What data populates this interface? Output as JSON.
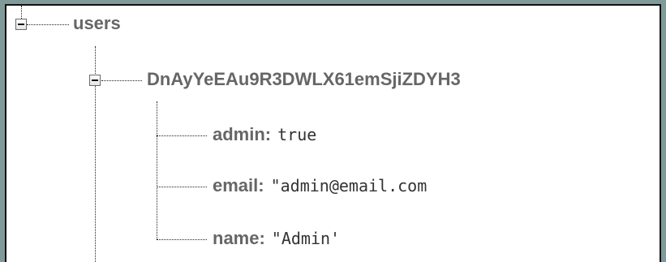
{
  "tree": {
    "root": {
      "key": "users"
    },
    "child": {
      "key": "DnAyYeEAu9R3DWLX61emSjiZDYH3",
      "fields": [
        {
          "key": "admin:",
          "value": "true"
        },
        {
          "key": "email:",
          "value": "\"admin@email.com"
        },
        {
          "key": "name:",
          "value": "\"Admin'"
        }
      ]
    }
  }
}
